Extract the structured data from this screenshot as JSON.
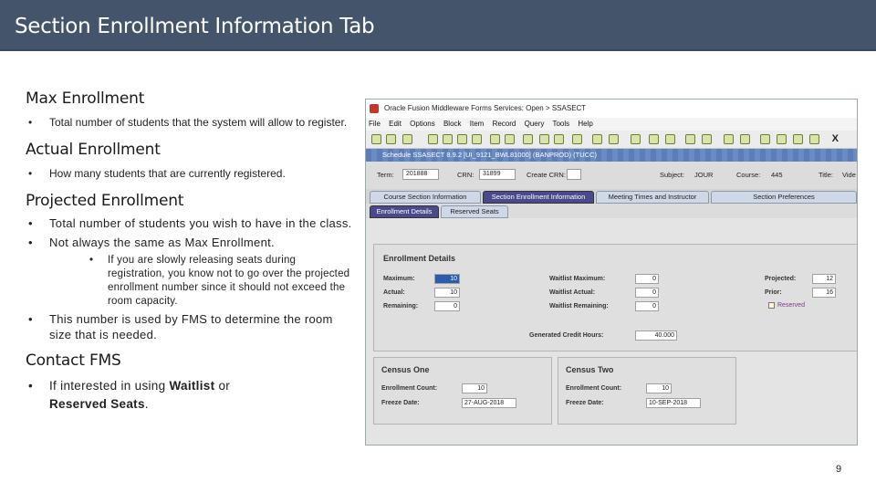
{
  "slide": {
    "title": "Section Enrollment Information Tab",
    "page_number": "9"
  },
  "sections": [
    {
      "heading": "Max Enrollment",
      "bullets": [
        "Total number of students that the system will allow to register."
      ]
    },
    {
      "heading": "Actual Enrollment",
      "bullets": [
        "How many students that are currently registered."
      ]
    },
    {
      "heading": "Projected Enrollment",
      "bullets": [
        "Total number of students you wish to have in the class.",
        "Not always the same as Max Enrollment."
      ],
      "sub_bullet": "If you are slowly releasing seats during registration, you know not to go over the projected enrollment number since it should not exceed the room capacity.",
      "bullet_after": "This number is used by FMS to determine the room size that is needed."
    },
    {
      "heading": "Contact FMS",
      "bullet_prefix": "If interested in using ",
      "bullet_bold1": "Waitlist",
      "bullet_mid": " or",
      "bullet_bold2": "Reserved Seats",
      "bullet_suffix": "."
    }
  ],
  "screenshot": {
    "app_title": "Oracle Fusion Middleware Forms Services: Open > SSASECT",
    "menu": [
      "File",
      "Edit",
      "Options",
      "Block",
      "Item",
      "Record",
      "Query",
      "Tools",
      "Help"
    ],
    "window_title": "Schedule SSASECT 8.9.2 [UI_9121_BWL81000] (BANPROD) (TUCC)",
    "key": {
      "term_label": "Term:",
      "term_value": "201888",
      "crn_label": "CRN:",
      "crn_value": "31899",
      "create_crn_label": "Create CRN:",
      "subject_label": "Subject:",
      "subject_value": "JOUR",
      "course_label": "Course:",
      "course_value": "445",
      "title_label": "Title:",
      "title_value": "Vide"
    },
    "tabs": [
      "Course Section Information",
      "Section Enrollment Information",
      "Meeting Times and Instructor",
      "Section Preferences"
    ],
    "subtabs": [
      "Enrollment Details",
      "Reserved Seats"
    ],
    "enrollment": {
      "title": "Enrollment Details",
      "maximum_label": "Maximum:",
      "maximum_value": "10",
      "actual_label": "Actual:",
      "actual_value": "10",
      "remaining_label": "Remaining:",
      "remaining_value": "0",
      "waitlist_max_label": "Waitlist Maximum:",
      "waitlist_max_value": "0",
      "waitlist_actual_label": "Waitlist Actual:",
      "waitlist_actual_value": "0",
      "waitlist_remaining_label": "Waitlist Remaining:",
      "waitlist_remaining_value": "0",
      "projected_label": "Projected:",
      "projected_value": "12",
      "prior_label": "Prior:",
      "prior_value": "16",
      "reserved_label": "Reserved",
      "credit_hours_label": "Generated Credit Hours:",
      "credit_hours_value": "40.000"
    },
    "census_one": {
      "title": "Census One",
      "count_label": "Enrollment Count:",
      "count_value": "10",
      "date_label": "Freeze Date:",
      "date_value": "27-AUG-2018"
    },
    "census_two": {
      "title": "Census Two",
      "count_label": "Enrollment Count:",
      "count_value": "10",
      "date_label": "Freeze Date:",
      "date_value": "10-SEP-2018"
    }
  }
}
